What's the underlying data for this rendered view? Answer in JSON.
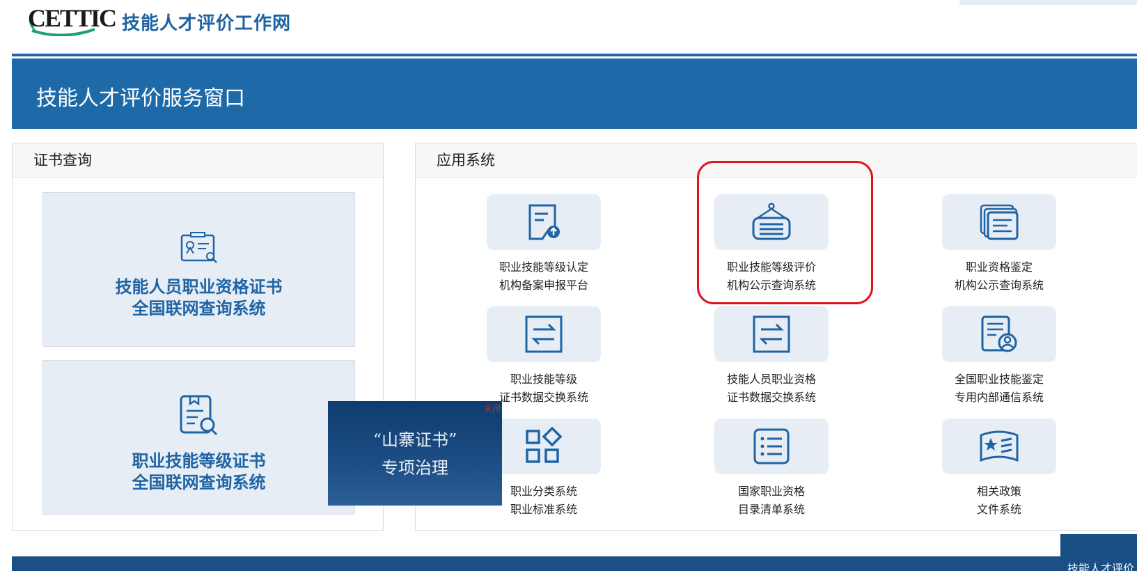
{
  "header": {
    "logo_text": "CETTIC",
    "site_name": "技能人才评价工作网"
  },
  "banner": {
    "title": "技能人才评价服务窗口"
  },
  "cert_panel": {
    "title": "证书查询",
    "cards": [
      {
        "icon": "certificate-search-icon",
        "line1": "技能人员职业资格证书",
        "line2": "全国联网查询系统"
      },
      {
        "icon": "document-search-icon",
        "line1": "职业技能等级证书",
        "line2": "全国联网查询系统"
      }
    ]
  },
  "app_panel": {
    "title": "应用系统",
    "items": [
      {
        "icon": "document-upload-icon",
        "line1": "职业技能等级认定",
        "line2": "机构备案申报平台"
      },
      {
        "icon": "notice-board-icon",
        "line1": "职业技能等级评价",
        "line2": "机构公示查询系统"
      },
      {
        "icon": "stacked-documents-icon",
        "line1": "职业资格鉴定",
        "line2": "机构公示查询系统"
      },
      {
        "icon": "exchange-icon",
        "line1": "职业技能等级",
        "line2": "证书数据交换系统"
      },
      {
        "icon": "exchange-icon",
        "line1": "技能人员职业资格",
        "line2": "证书数据交换系统"
      },
      {
        "icon": "document-user-icon",
        "line1": "全国职业技能鉴定",
        "line2": "专用内部通信系统"
      },
      {
        "icon": "category-grid-icon",
        "line1": "职业分类系统",
        "line2": "职业标准系统"
      },
      {
        "icon": "list-icon",
        "line1": "国家职业资格",
        "line2": "目录清单系统"
      },
      {
        "icon": "policy-book-icon",
        "line1": "相关政策",
        "line2": "文件系统"
      }
    ]
  },
  "popup": {
    "close_label": "关闭",
    "line1": "“山寨证书”",
    "line2": "专项治理"
  },
  "corner_float": {
    "text": "技能人才评价"
  },
  "colors": {
    "brand_blue": "#1e69a8",
    "title_blue": "#1f64a4",
    "tile_bg": "#e7edf5",
    "highlight_red": "#e0141e"
  }
}
